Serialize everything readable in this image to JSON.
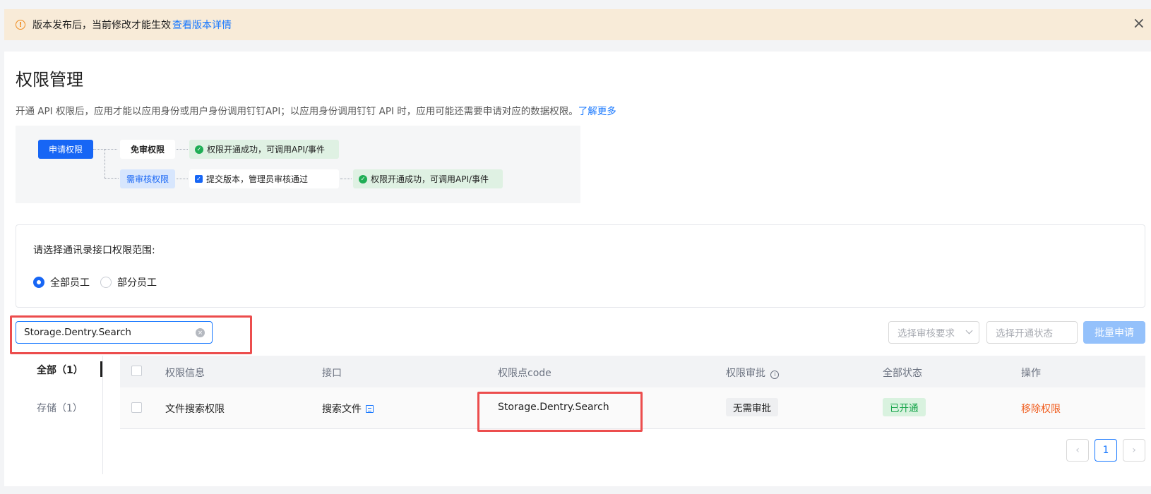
{
  "notice": {
    "text": "版本发布后，当前修改才能生效",
    "link": "查看版本详情",
    "icon": "info-icon",
    "close_icon": "close-icon"
  },
  "page": {
    "title": "权限管理",
    "description": "开通 API 权限后，应用才能以应用身份或用户身份调用钉钉API；以应用身份调用钉钉 API 时，应用可能还需要申请对应的数据权限。",
    "learn_more": "了解更多"
  },
  "flow": {
    "apply": "申请权限",
    "no_review": "免审权限",
    "need_review": "需审核权限",
    "success": "权限开通成功，可调用API/事件",
    "submit": "提交版本，管理员审核通过",
    "success2": "权限开通成功，可调用API/事件"
  },
  "scope": {
    "label": "请选择通讯录接口权限范围:",
    "options": [
      {
        "label": "全部员工",
        "selected": true
      },
      {
        "label": "部分员工",
        "selected": false
      }
    ]
  },
  "filters": {
    "search_value": "Storage.Dentry.Search",
    "review_placeholder": "选择审核要求",
    "status_placeholder": "选择开通状态",
    "batch_button": "批量申请"
  },
  "side_tabs": [
    {
      "label": "全部（1）",
      "active": true
    },
    {
      "label": "存储（1）",
      "active": false
    }
  ],
  "table": {
    "headers": [
      "权限信息",
      "接口",
      "权限点code",
      "权限审批",
      "全部状态",
      "操作"
    ],
    "rows": [
      {
        "info": "文件搜索权限",
        "api": "搜索文件",
        "code": "Storage.Dentry.Search",
        "approval": "无需审批",
        "status": "已开通",
        "action": "移除权限"
      }
    ]
  },
  "pagination": {
    "current": "1",
    "prev": "‹",
    "next": "›"
  },
  "colors": {
    "primary": "#1766f5",
    "link": "#1677ff",
    "success": "#1aa64d",
    "danger": "#f05a1a",
    "highlight_box": "#ec4d4d"
  }
}
